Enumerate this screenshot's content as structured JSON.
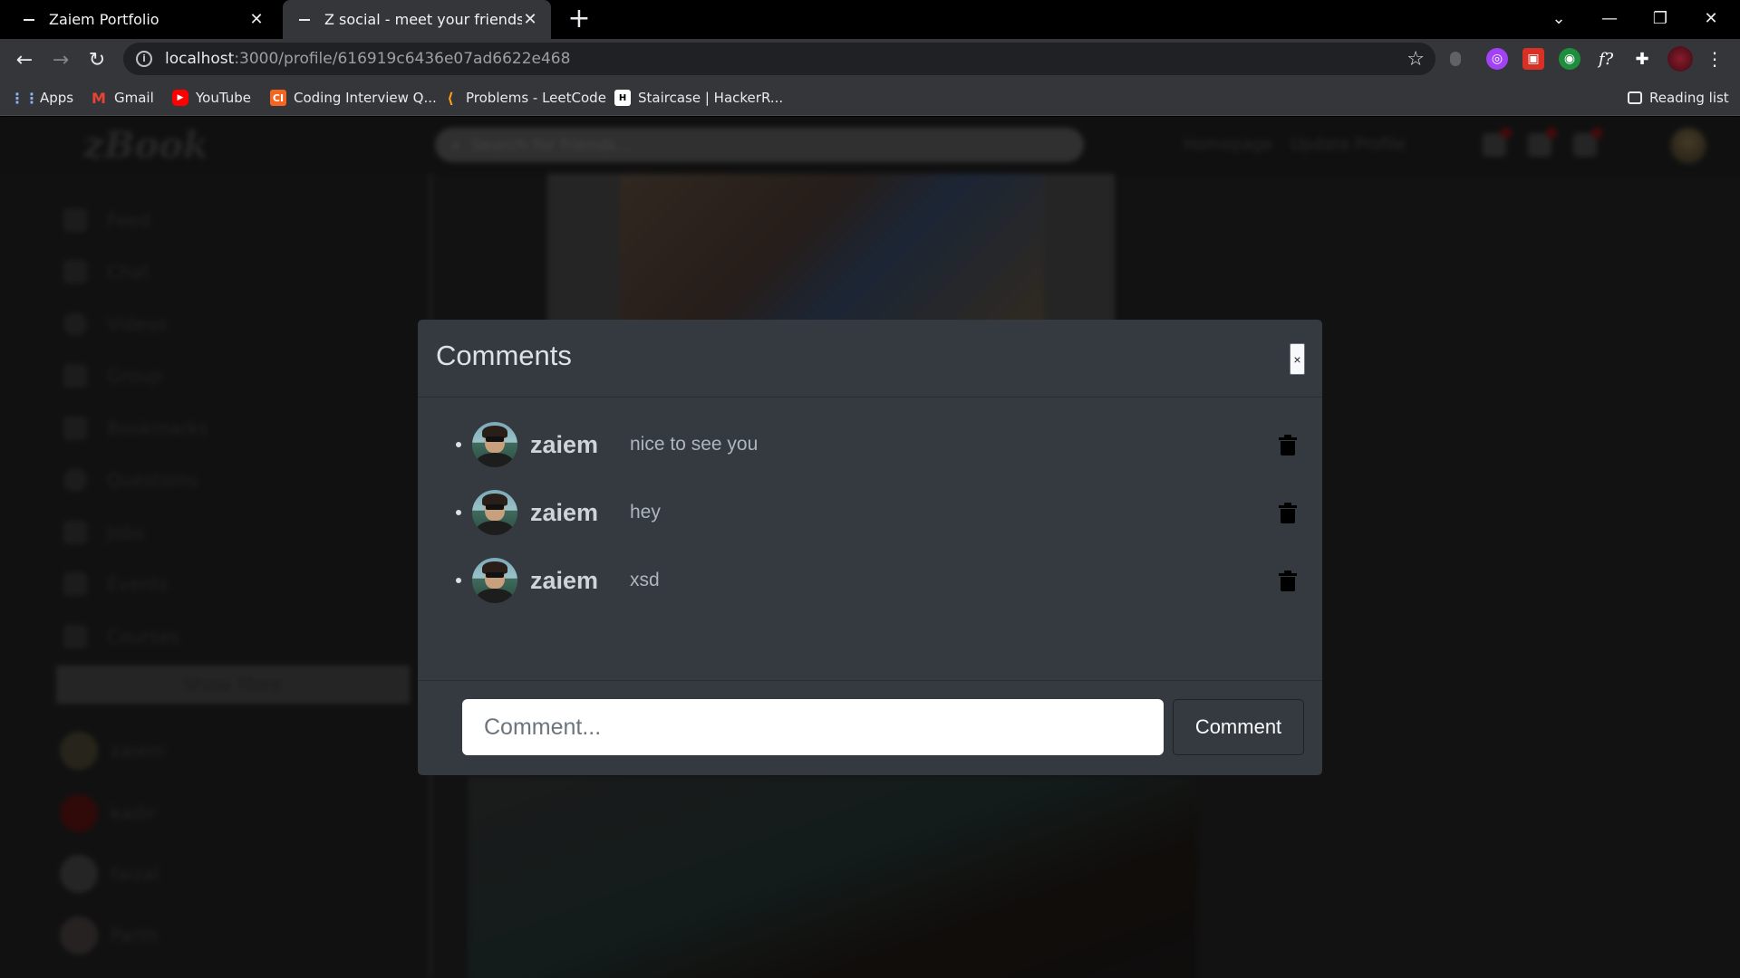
{
  "browser": {
    "tabs": [
      {
        "title": "Zaiem Portfolio",
        "active": false
      },
      {
        "title": "Z social - meet your friends online",
        "active": true
      }
    ],
    "url_host": "localhost",
    "url_rest": ":3000/profile/616919c6436e07ad6622e468",
    "bookmarks": [
      {
        "label": "Apps",
        "icon": "apps-grid-icon"
      },
      {
        "label": "Gmail",
        "icon": "gmail-icon"
      },
      {
        "label": "YouTube",
        "icon": "youtube-icon"
      },
      {
        "label": "Coding Interview Q...",
        "icon": "codinginterview-icon"
      },
      {
        "label": "Problems - LeetCode",
        "icon": "leetcode-icon"
      },
      {
        "label": "Staircase | HackerR...",
        "icon": "hackerrank-icon"
      }
    ],
    "reading_list": "Reading list"
  },
  "app": {
    "logo": "zBook",
    "search_placeholder": "Search for friends...",
    "nav": {
      "homepage": "Homepage",
      "update_profile": "Update Profile"
    },
    "sidebar": {
      "items": [
        "Feed",
        "Chat",
        "Videos",
        "Group",
        "Bookmarks",
        "Questions",
        "Jobs",
        "Events",
        "Courses"
      ],
      "show_more": "Show More",
      "friends": [
        "zaiem",
        "kadir",
        "faizal",
        "Parth"
      ]
    }
  },
  "modal": {
    "title": "Comments",
    "close_label": "×",
    "comments": [
      {
        "user": "zaiem",
        "text": "nice to see you"
      },
      {
        "user": "zaiem",
        "text": "hey"
      },
      {
        "user": "zaiem",
        "text": "xsd"
      }
    ],
    "input_placeholder": "Comment...",
    "submit_label": "Comment"
  }
}
